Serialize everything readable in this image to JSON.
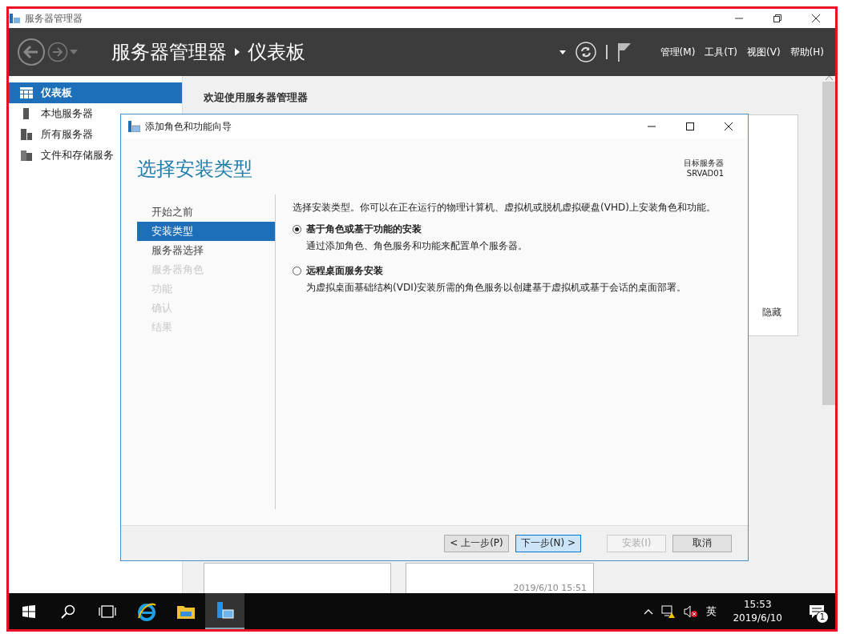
{
  "window": {
    "title": "服务器管理器"
  },
  "header": {
    "app": "服务器管理器",
    "page": "仪表板",
    "menus": [
      "管理(M)",
      "工具(T)",
      "视图(V)",
      "帮助(H)"
    ]
  },
  "sidebar": {
    "items": [
      {
        "label": "仪表板",
        "selected": true,
        "kind": "dashboard"
      },
      {
        "label": "本地服务器",
        "selected": false,
        "kind": "local"
      },
      {
        "label": "所有服务器",
        "selected": false,
        "kind": "all"
      },
      {
        "label": "文件和存储服务",
        "selected": false,
        "kind": "files"
      }
    ]
  },
  "main": {
    "welcome": "欢迎使用服务器管理器",
    "hide_link": "隐藏",
    "timestamp": "2019/6/10 15:51"
  },
  "dialog": {
    "title": "添加角色和功能向导",
    "heading": "选择安装类型",
    "target_label": "目标服务器",
    "target_name": "SRVAD01",
    "steps": [
      {
        "label": "开始之前",
        "selected": false,
        "disabled": false
      },
      {
        "label": "安装类型",
        "selected": true,
        "disabled": false
      },
      {
        "label": "服务器选择",
        "selected": false,
        "disabled": false
      },
      {
        "label": "服务器角色",
        "selected": false,
        "disabled": true
      },
      {
        "label": "功能",
        "selected": false,
        "disabled": true
      },
      {
        "label": "确认",
        "selected": false,
        "disabled": true
      },
      {
        "label": "结果",
        "selected": false,
        "disabled": true
      }
    ],
    "intro": "选择安装类型。你可以在正在运行的物理计算机、虚拟机或脱机虚拟硬盘(VHD)上安装角色和功能。",
    "options": [
      {
        "title": "基于角色或基于功能的安装",
        "description": "通过添加角色、角色服务和功能来配置单个服务器。",
        "selected": true
      },
      {
        "title": "远程桌面服务安装",
        "description": "为虚拟桌面基础结构(VDI)安装所需的角色服务以创建基于虚拟机或基于会话的桌面部署。",
        "selected": false
      }
    ],
    "buttons": [
      {
        "label": "< 上一步(P)",
        "kind": "normal"
      },
      {
        "label": "下一步(N) >",
        "kind": "default"
      },
      {
        "label": "安装(I)",
        "kind": "disabled"
      },
      {
        "label": "取消",
        "kind": "normal"
      }
    ]
  },
  "taskbar": {
    "apps": [
      {
        "kind": "ie",
        "active": false
      },
      {
        "kind": "explorer",
        "active": false
      },
      {
        "kind": "server-manager",
        "active": true
      }
    ],
    "ime": "英",
    "time": "15:53",
    "date": "2019/6/10",
    "notification_count": "1"
  }
}
